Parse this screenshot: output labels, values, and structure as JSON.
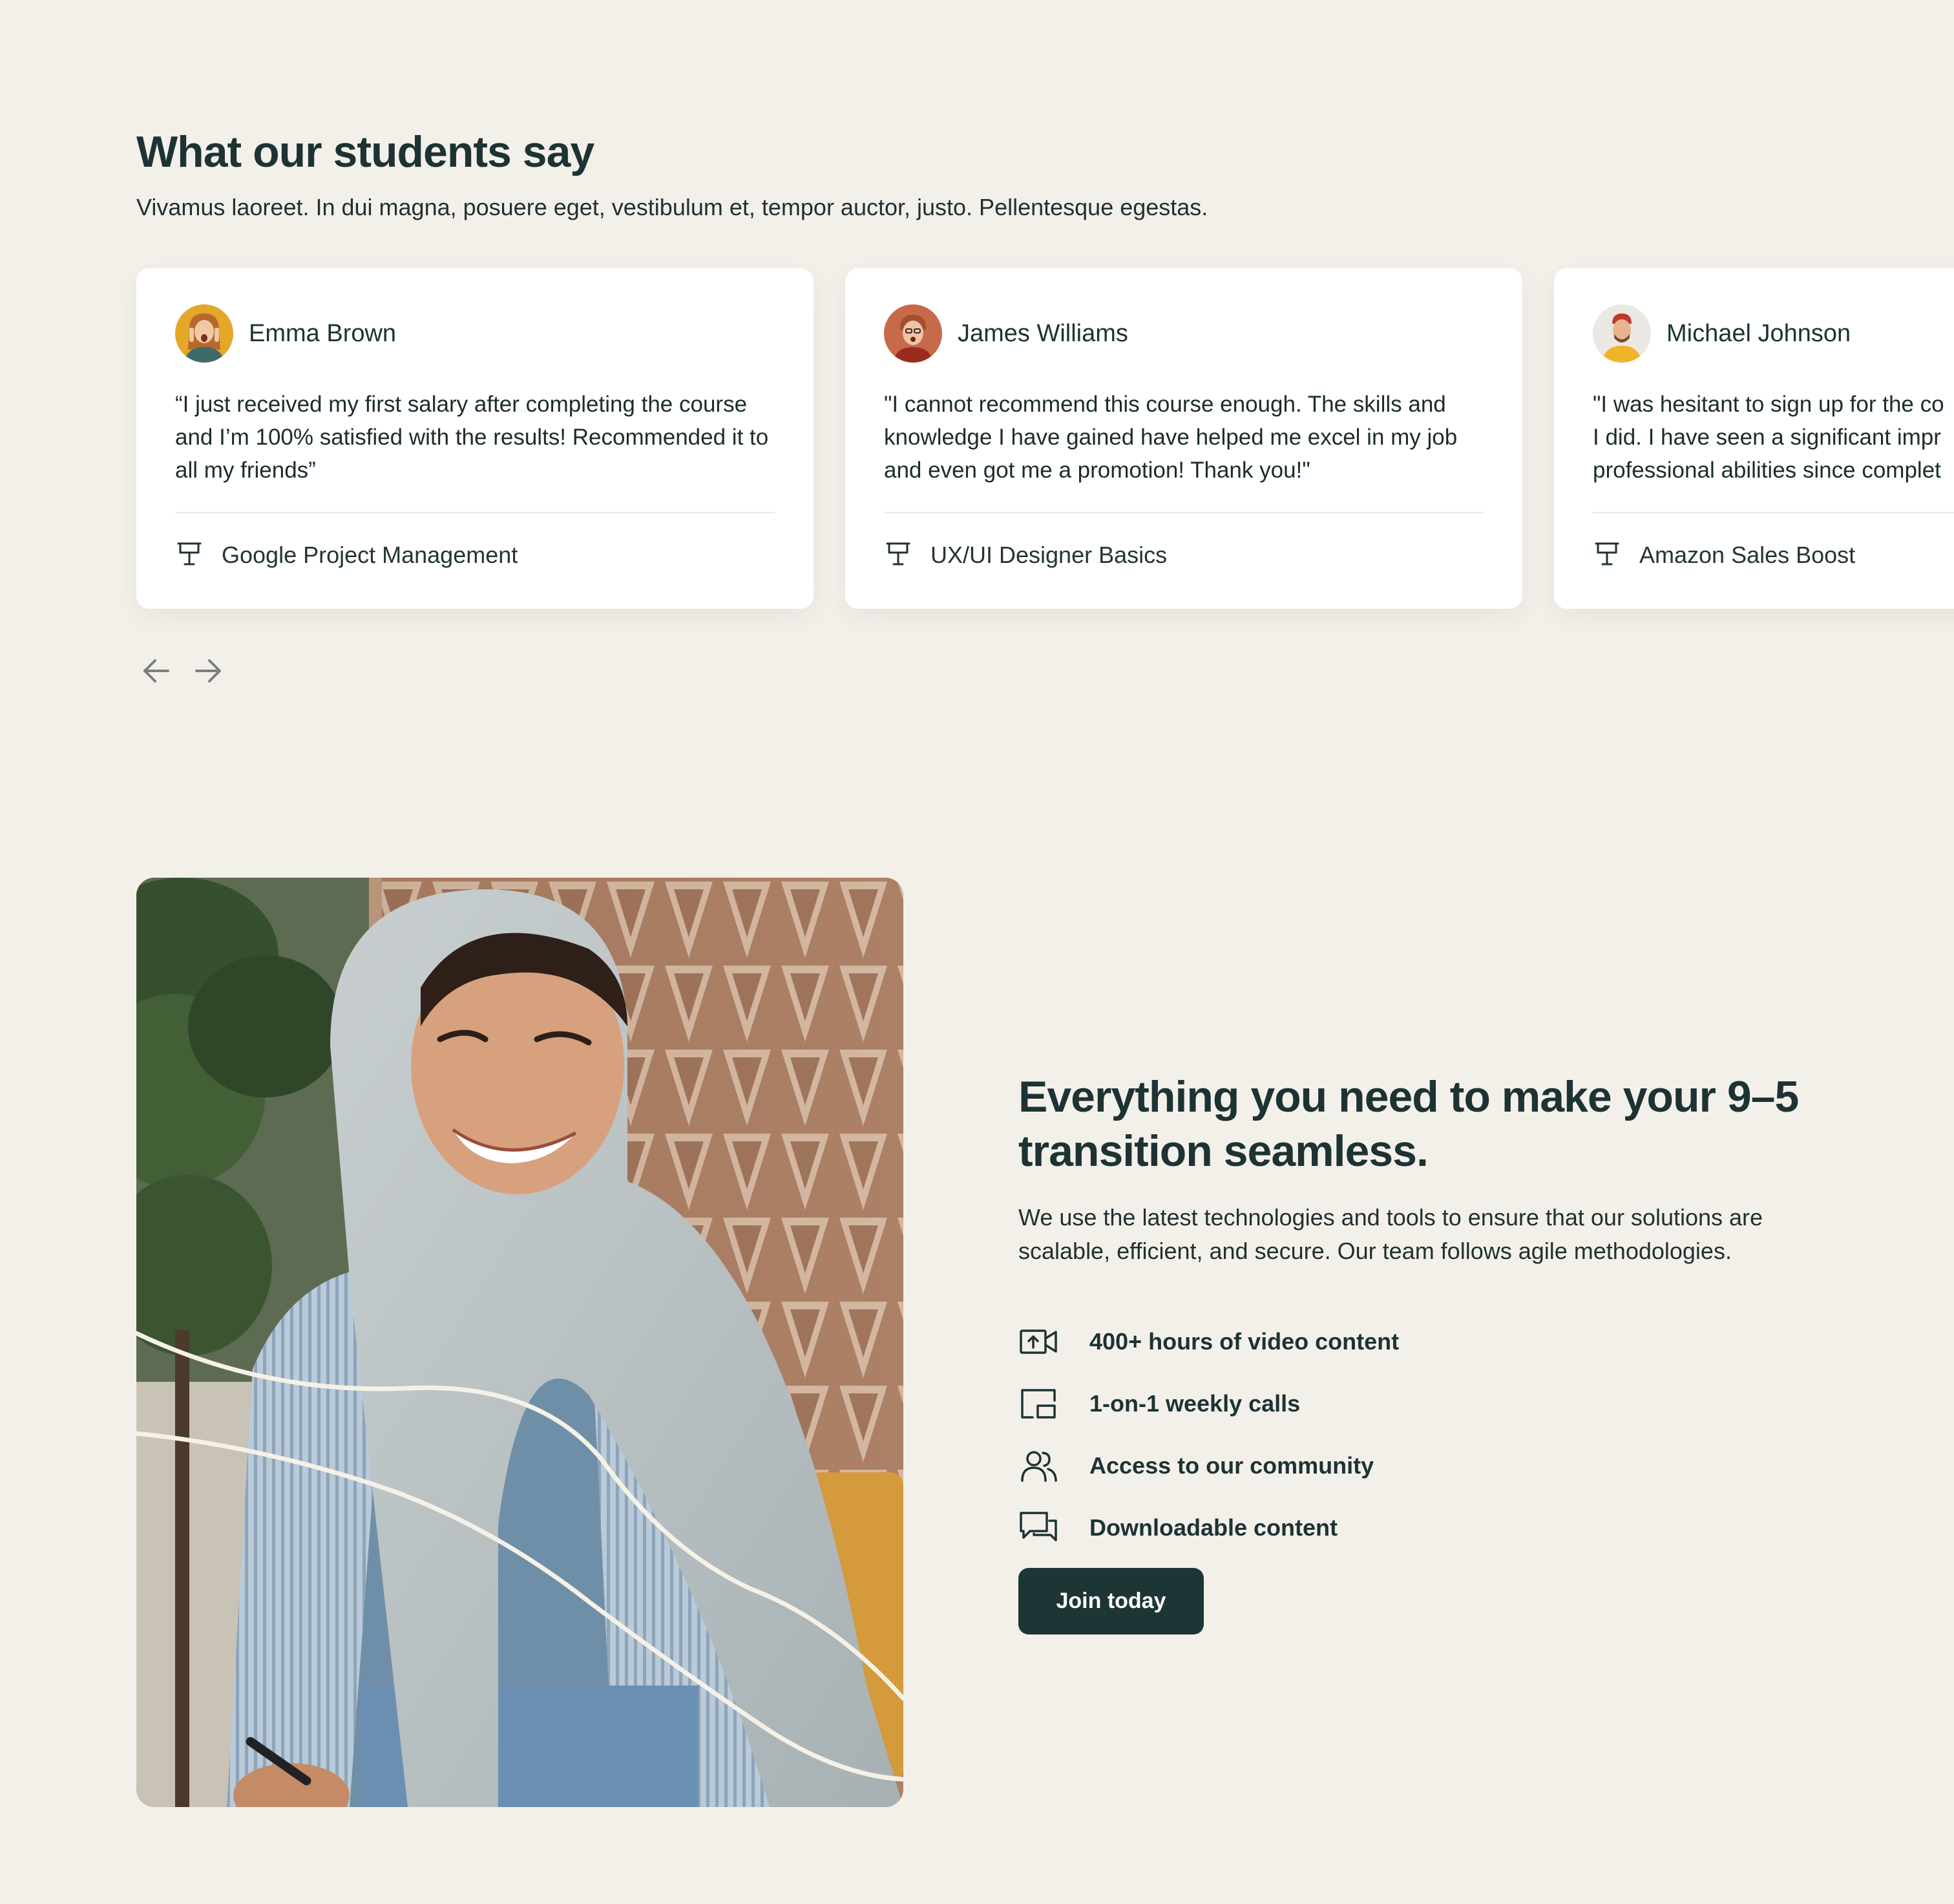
{
  "testimonials": {
    "title": "What our students say",
    "subtitle": "Vivamus laoreet. In dui magna, posuere eget, vestibulum et, tempor auctor, justo. Pellentesque egestas.",
    "cards": [
      {
        "name": "Emma Brown",
        "quote": "“I just received my first salary after completing the course and I’m 100% satisfied with the results! Recommended it to all my friends”",
        "course": "Google Project Management"
      },
      {
        "name": "James Williams",
        "quote": "\"I cannot recommend this course enough. The skills and knowledge I have gained have helped me excel in my job and even got me a promotion! Thank you!\"",
        "course": "UX/UI Designer Basics"
      },
      {
        "name": "Michael Johnson",
        "quote_lines": [
          "\"I was hesitant to sign up for the co",
          "I did. I have seen a significant impr",
          "professional abilities since complet"
        ],
        "course": "Amazon Sales Boost"
      }
    ],
    "icons": {
      "prev": "arrow-left-icon",
      "next": "arrow-right-icon",
      "course": "presentation-icon"
    }
  },
  "feature": {
    "title": "Everything you need to make your 9–5 transition seamless.",
    "description": "We use the latest technologies and tools to ensure that our solutions are scalable, efficient, and secure. Our team follows agile methodologies.",
    "items": [
      {
        "label": "400+ hours of video content",
        "icon": "video-icon"
      },
      {
        "label": "1-on-1 weekly calls",
        "icon": "screen-share-icon"
      },
      {
        "label": "Access to our community",
        "icon": "users-icon"
      },
      {
        "label": "Downloadable content",
        "icon": "chat-icon"
      }
    ],
    "cta": "Join today"
  },
  "colors": {
    "background": "#f3f0ea",
    "card": "#ffffff",
    "text_dark": "#1d3333",
    "button": "#1e3535"
  }
}
